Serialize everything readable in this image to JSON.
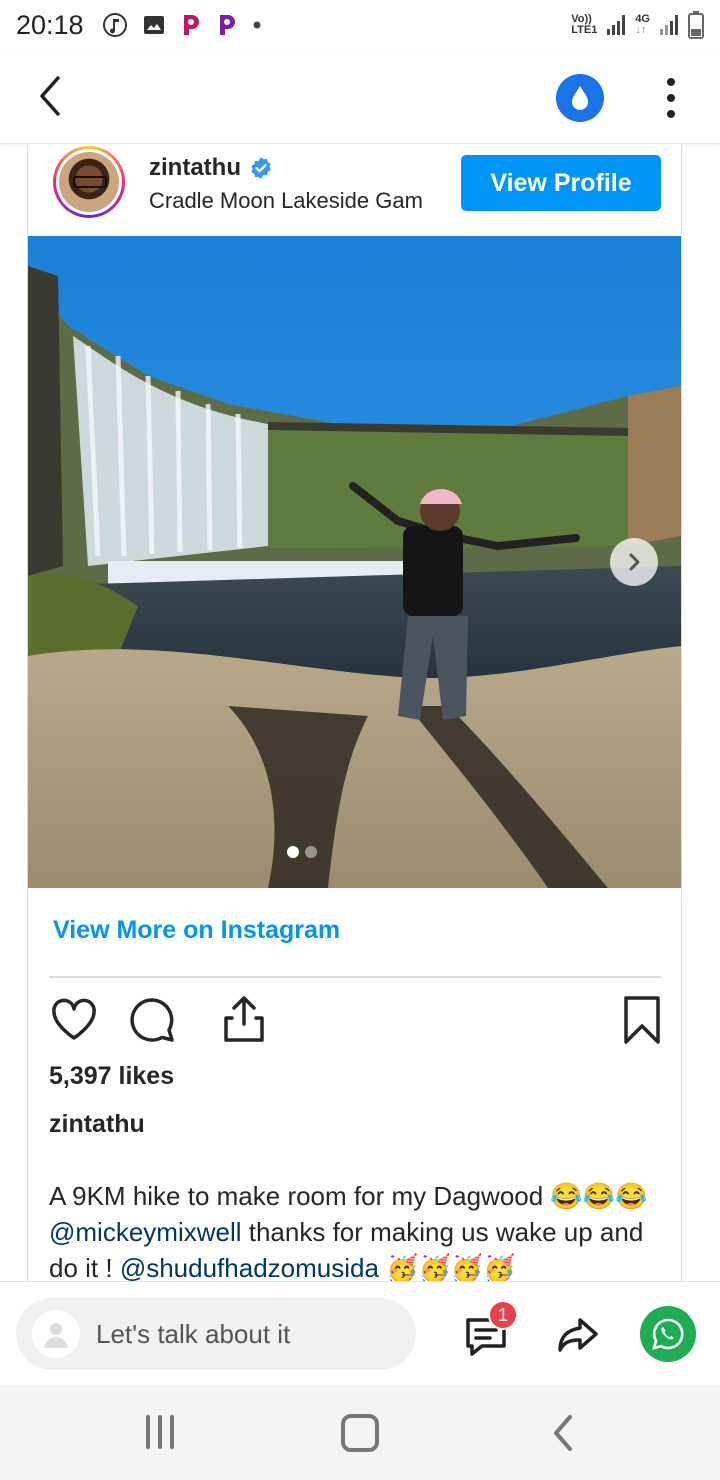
{
  "status_bar": {
    "time": "20:18",
    "network_top": "Vo))",
    "network_bottom": "LTE1",
    "network2_top": "4G"
  },
  "app_bar": {
    "back_icon": "chevron-left-icon",
    "drop_icon": "water-drop-icon",
    "more_icon": "more-vert-icon"
  },
  "post": {
    "username": "zintathu",
    "location": "Cradle Moon Lakeside Gam",
    "view_profile_label": "View Profile",
    "view_more_label": "View More on Instagram",
    "likes": "5,397 likes",
    "caption_user": "zintathu",
    "caption_parts": {
      "p1": "A 9KM hike to make room for my Dagwood 😂😂😂 ",
      "m1": "@mickeymixwell",
      "p2": " thanks for making us wake up and do it ! ",
      "m2": "@shudufhadzomusida",
      "p3": " 🥳🥳🥳🥳"
    },
    "carousel_dots": 2,
    "carousel_active": 1
  },
  "comment_bar": {
    "placeholder": "Let's talk about it",
    "badge_count": "1"
  },
  "colors": {
    "instagram_blue": "#0095f6",
    "drop_button": "#1a73e8",
    "whatsapp": "#1fad53",
    "badge": "#e8414b"
  }
}
